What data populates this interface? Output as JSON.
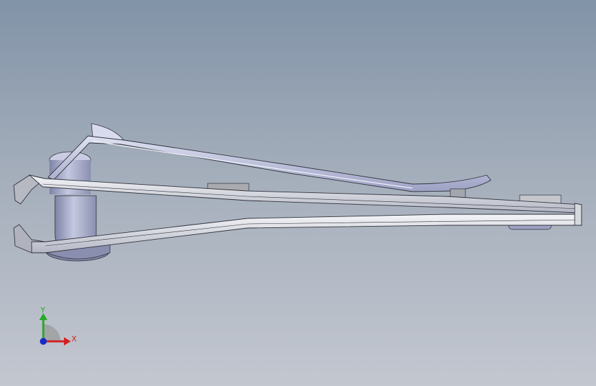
{
  "viewport": {
    "background_top": "#8193a7",
    "background_bottom": "#c3c7d0"
  },
  "model": {
    "part": "nail-clipper-assembly",
    "colors": {
      "metal_light": "#e9ecf2",
      "metal_mid": "#c9ccd8",
      "metal_dark": "#8e92a8",
      "edge": "#2e3038",
      "lever": "#b7bbd8",
      "pin": "#a8acc8"
    }
  },
  "triad": {
    "x_label": "X",
    "y_label": "Y",
    "x_color": "#d42020",
    "y_color": "#28a828",
    "z_color": "#1a2ac8"
  }
}
